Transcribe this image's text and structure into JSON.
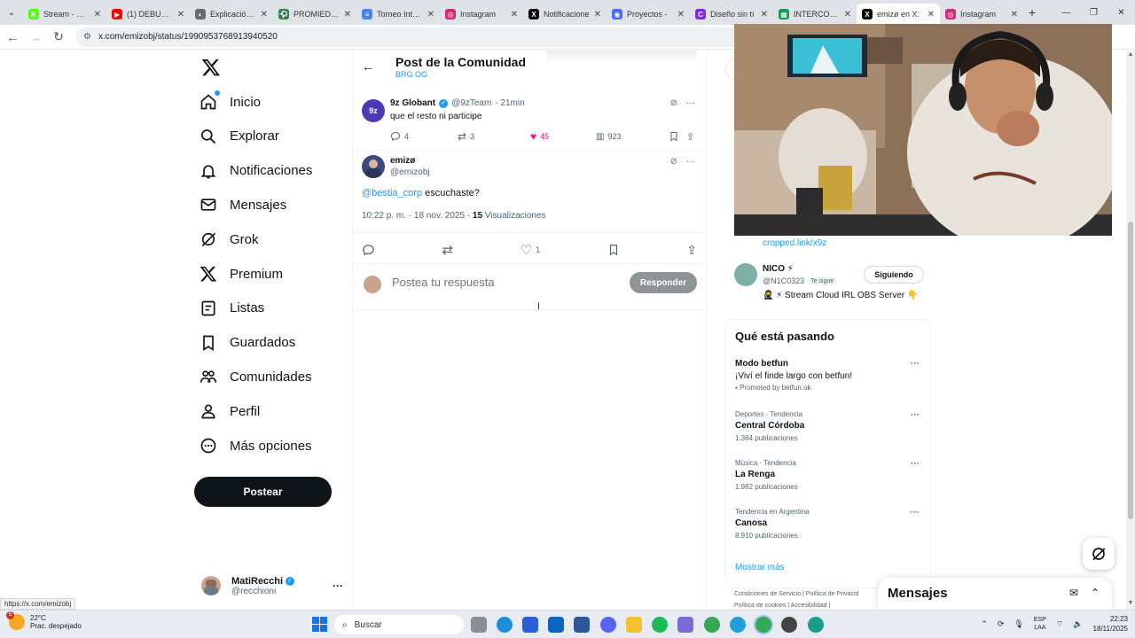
{
  "browser": {
    "tabs": [
      {
        "label": "Stream - Kick",
        "color": "#53fc18",
        "glyph": "K"
      },
      {
        "label": "(1) DEBUTÉ en",
        "color": "#ff0000",
        "glyph": "▶"
      },
      {
        "label": "Explicación h",
        "color": "#6b6b6b",
        "glyph": "◐"
      },
      {
        "label": "PROMIEDOS",
        "color": "#1e8e3e",
        "glyph": "⚽"
      },
      {
        "label": "Torneo Intern",
        "color": "#4285f4",
        "glyph": "≡"
      },
      {
        "label": "Instagram",
        "color": "#d62976",
        "glyph": "◎"
      },
      {
        "label": "Notificacione",
        "color": "#000000",
        "glyph": "X"
      },
      {
        "label": "Proyectos -",
        "color": "#4a6cf7",
        "glyph": "◉"
      },
      {
        "label": "Diseño sin tí",
        "color": "#7d2ae8",
        "glyph": "C"
      },
      {
        "label": "INTERCOMU",
        "color": "#0f9d58",
        "glyph": "▦"
      },
      {
        "label": "emizø en X:",
        "color": "#000000",
        "glyph": "X"
      },
      {
        "label": "Instagram",
        "color": "#d62976",
        "glyph": "◎"
      }
    ],
    "url": "x.com/emizobj/status/1990953768913940520",
    "status_url": "https://x.com/emizobj"
  },
  "nav": {
    "items": [
      {
        "label": "Inicio",
        "icon": "home-icon"
      },
      {
        "label": "Explorar",
        "icon": "search-icon"
      },
      {
        "label": "Notificaciones",
        "icon": "bell-icon"
      },
      {
        "label": "Mensajes",
        "icon": "mail-icon"
      },
      {
        "label": "Grok",
        "icon": "grok-icon"
      },
      {
        "label": "Premium",
        "icon": "x-icon"
      },
      {
        "label": "Listas",
        "icon": "list-icon"
      },
      {
        "label": "Guardados",
        "icon": "bookmark-icon"
      },
      {
        "label": "Comunidades",
        "icon": "people-icon"
      },
      {
        "label": "Perfil",
        "icon": "person-icon"
      },
      {
        "label": "Más opciones",
        "icon": "more-icon"
      }
    ],
    "post_label": "Postear",
    "account_name": "MatiRecchi",
    "account_handle": "@recchioni"
  },
  "header": {
    "title": "Post de la Comunidad",
    "subtitle": "BRG OG"
  },
  "reply": {
    "name": "9z Globant",
    "handle": "@9zTeam",
    "time": "· 21min",
    "text": "que el resto ni participe",
    "replies": "4",
    "reposts": "3",
    "likes": "45",
    "views": "923"
  },
  "tweet": {
    "name": "emizø",
    "handle": "@emizobj",
    "mention": "@bestia_corp",
    "text": " escuchaste?",
    "timestamp": "10:22 p. m. · 18 nov. 2025 · ",
    "views_count": "15",
    "views_label": " Visualizaciones",
    "likes": "1"
  },
  "compose": {
    "placeholder": "Postea tu respuesta",
    "button": "Responder"
  },
  "sidebar": {
    "link_fragment": "cropped.link/x9z",
    "follow": {
      "name": "NICO ⚡",
      "handle": "@N1C0323",
      "badge": "Te sigue",
      "button": "Siguiendo",
      "bio": "🥷 ⚡ Stream Cloud IRL OBS Server 👇"
    },
    "trends_title": "Qué está pasando",
    "promo": {
      "name": "Modo betfun",
      "text": "¡Viví el finde largo con betfun!",
      "promoted": "Promoted by betfun.ok"
    },
    "trends": [
      {
        "context": "Deportes · Tendencia",
        "name": "Central Córdoba",
        "count": "1.364 publicaciones"
      },
      {
        "context": "Música · Tendencia",
        "name": "La Renga",
        "count": "1.982 publicaciones"
      },
      {
        "context": "Tendencia en Argentina",
        "name": "Canosa",
        "count": "8.910 publicaciones"
      }
    ],
    "show_more": "Mostrar más",
    "footer1": "Condiciones de Servicio  |  Política de Privacid",
    "footer2": "Política de cookies  |  Accesibilidad  |"
  },
  "messages": {
    "title": "Mensajes"
  },
  "taskbar": {
    "temp": "22°C",
    "weather": "Prac. despejado",
    "search": "Buscar",
    "lang1": "ESP",
    "lang2": "LAA",
    "time": "22:23",
    "date": "18/11/2025",
    "weather_badge": "5"
  }
}
